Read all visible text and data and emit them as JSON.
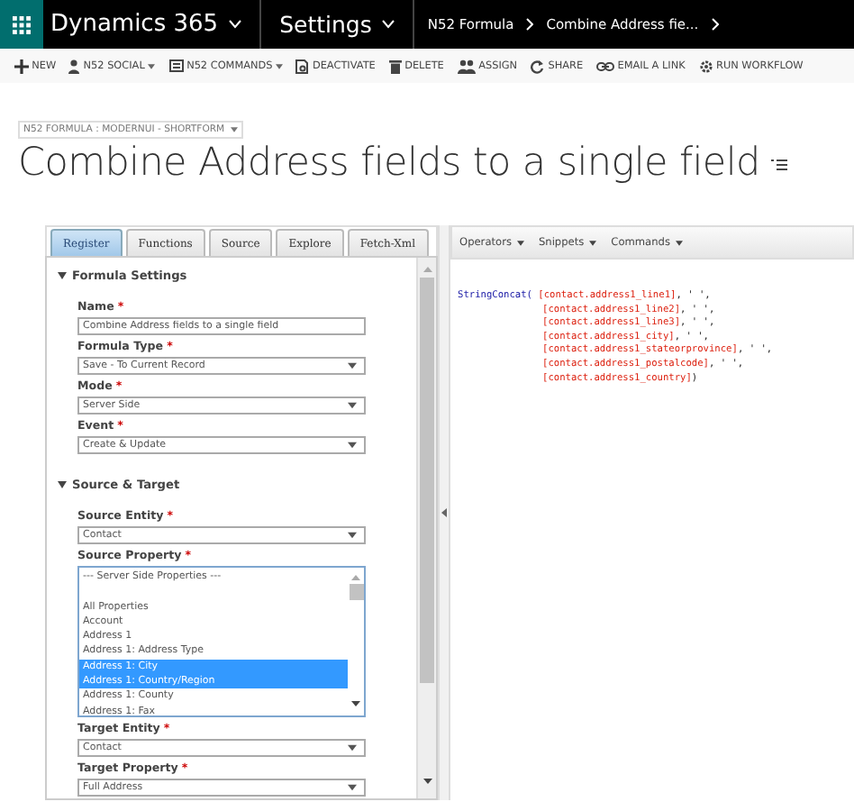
{
  "nav": {
    "app": "Dynamics 365",
    "area": "Settings",
    "breadcrumbs": [
      "N52 Formula",
      "Combine Address fie..."
    ]
  },
  "commands": [
    {
      "label": "NEW",
      "menu": false
    },
    {
      "label": "N52 SOCIAL",
      "menu": true
    },
    {
      "label": "N52 COMMANDS",
      "menu": true
    },
    {
      "label": "DEACTIVATE",
      "menu": false
    },
    {
      "label": "DELETE",
      "menu": false
    },
    {
      "label": "ASSIGN",
      "menu": false
    },
    {
      "label": "SHARE",
      "menu": false
    },
    {
      "label": "EMAIL A LINK",
      "menu": false
    },
    {
      "label": "RUN WORKFLOW",
      "menu": false
    }
  ],
  "form_selector": "N52 FORMULA : MODERNUI - SHORTFORM",
  "title": "Combine Address fields to a single field",
  "tabs": [
    {
      "label": "Register",
      "selected": true
    },
    {
      "label": "Functions",
      "selected": false
    },
    {
      "label": "Source",
      "selected": false
    },
    {
      "label": "Explore",
      "selected": false
    },
    {
      "label": "Fetch-Xml",
      "selected": false
    }
  ],
  "sections": [
    {
      "title": "Formula Settings",
      "expanded": true,
      "fields": [
        {
          "kind": "text",
          "label": "Name",
          "required_marker": "*",
          "value": "Combine Address fields to a single field"
        },
        {
          "kind": "select",
          "label": "Formula Type",
          "required_marker": "*",
          "value": "Save - To Current Record"
        },
        {
          "kind": "select",
          "label": "Mode",
          "required_marker": "*",
          "value": "Server Side"
        },
        {
          "kind": "select",
          "label": "Event",
          "required_marker": "*",
          "value": "Create & Update"
        }
      ]
    },
    {
      "title": "Source & Target",
      "expanded": true,
      "fields": [
        {
          "kind": "select",
          "label": "Source Entity",
          "required_marker": "*",
          "value": "Contact"
        },
        {
          "kind": "list",
          "label": "Source Property",
          "required_marker": "*",
          "options": [
            {
              "kind": "group",
              "label": "--- Server Side Properties ---"
            },
            {
              "kind": "option",
              "label": "All Properties",
              "selected": false
            },
            {
              "kind": "option",
              "label": "Account",
              "selected": false
            },
            {
              "kind": "option",
              "label": "Address 1",
              "selected": false
            },
            {
              "kind": "option",
              "label": "Address 1: Address Type",
              "selected": false
            },
            {
              "kind": "option",
              "label": "Address 1: City",
              "selected": true
            },
            {
              "kind": "option",
              "label": "Address 1: Country/Region",
              "selected": true
            },
            {
              "kind": "option",
              "label": "Address 1: County",
              "selected": false
            },
            {
              "kind": "option",
              "label": "Address 1: Fax",
              "selected": false
            }
          ]
        },
        {
          "kind": "select",
          "label": "Target Entity",
          "required_marker": "*",
          "value": "Contact"
        },
        {
          "kind": "select",
          "label": "Target Property",
          "required_marker": "*",
          "value": "Full Address"
        }
      ]
    }
  ],
  "editor_menus": [
    "Operators",
    "Snippets",
    "Commands"
  ],
  "code": [
    {
      "function": "StringConcat(",
      "field": "[contact.address1_line1]",
      "tail": ", ' ',"
    },
    {
      "field": "[contact.address1_line2]",
      "tail": ", ' ',"
    },
    {
      "field": "[contact.address1_line3]",
      "tail": ", ' ',"
    },
    {
      "field": "[contact.address1_city]",
      "tail": ", ' ',"
    },
    {
      "field": "[contact.address1_stateorprovince]",
      "tail": ", ' ',"
    },
    {
      "field": "[contact.address1_postalcode]",
      "tail": ", ' ',"
    },
    {
      "field": "[contact.address1_country]",
      "tail": ")"
    }
  ]
}
